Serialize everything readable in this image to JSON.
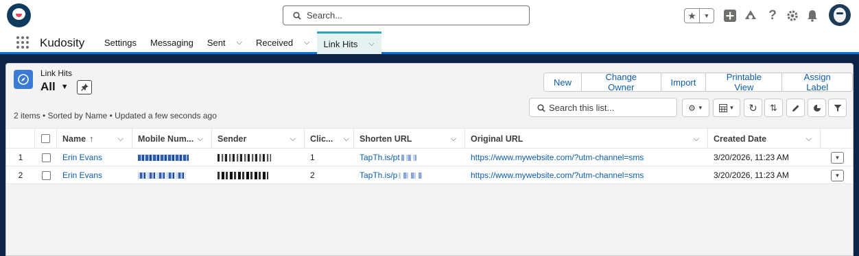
{
  "header": {
    "search_placeholder": "Search...",
    "icons": [
      "star-icon",
      "chevron-down-icon",
      "plus-icon",
      "cloud-icon",
      "help-icon",
      "gear-icon",
      "bell-icon",
      "avatar"
    ]
  },
  "nav": {
    "app_name": "Kudosity",
    "items": [
      {
        "label": "Settings",
        "has_menu": false,
        "active": false
      },
      {
        "label": "Messaging",
        "has_menu": false,
        "active": false
      },
      {
        "label": "Sent",
        "has_menu": true,
        "active": false
      },
      {
        "label": "Received",
        "has_menu": true,
        "active": false
      },
      {
        "label": "Link Hits",
        "has_menu": true,
        "active": true
      }
    ]
  },
  "list_view": {
    "object_label": "Link Hits",
    "view_name": "All",
    "info": "2 items • Sorted by Name • Updated a few seconds ago",
    "search_placeholder": "Search this list...",
    "buttons": [
      "New",
      "Change Owner",
      "Import",
      "Printable View",
      "Assign Label"
    ]
  },
  "table": {
    "columns": [
      {
        "label": "Name",
        "sort": "↑"
      },
      {
        "label": "Mobile Num..."
      },
      {
        "label": "Sender"
      },
      {
        "label": "Clic..."
      },
      {
        "label": "Shorten URL"
      },
      {
        "label": "Original URL"
      },
      {
        "label": "Created Date"
      }
    ],
    "rows": [
      {
        "num": "1",
        "name": "Erin Evans",
        "clicks": "1",
        "shorten_url": "TapTh.is/pt",
        "original_url": "https://www.mywebsite.com/?utm-channel=sms",
        "created": "3/20/2026, 11:23 AM"
      },
      {
        "num": "2",
        "name": "Erin Evans",
        "clicks": "2",
        "shorten_url": "TapTh.is/p",
        "original_url": "https://www.mywebsite.com/?utm-channel=sms",
        "created": "3/20/2026, 11:23 AM"
      }
    ]
  },
  "colors": {
    "brand_navy": "#0f3b5f",
    "active_tab_accent": "#2ca4b4",
    "link": "#0b5cab",
    "page_background": "#0b2447"
  }
}
